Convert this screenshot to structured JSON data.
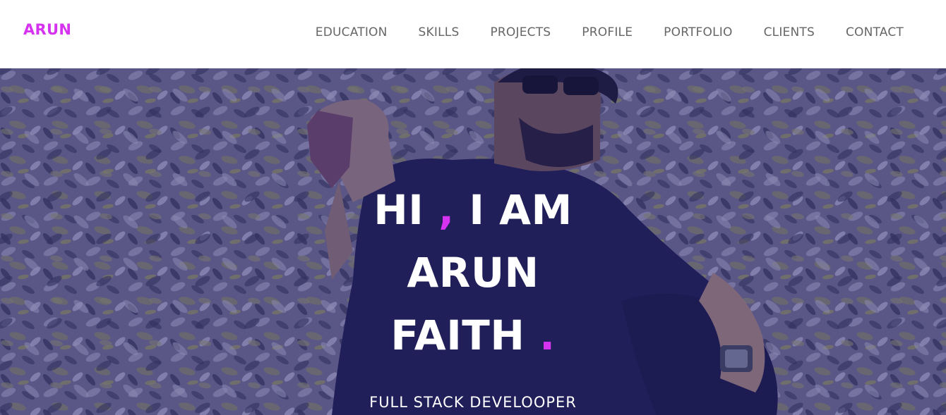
{
  "colors": {
    "accent": "#d633f0",
    "nav_text": "#666666",
    "overlay": "#2a2a6e"
  },
  "brand": {
    "name": "ARUN"
  },
  "nav": {
    "items": [
      {
        "label": "EDUCATION"
      },
      {
        "label": "SKILLS"
      },
      {
        "label": "PROJECTS"
      },
      {
        "label": "PROFILE"
      },
      {
        "label": "PORTFOLIO"
      },
      {
        "label": "CLIENTS"
      },
      {
        "label": "CONTACT"
      }
    ]
  },
  "hero": {
    "greeting": "HI",
    "comma": ",",
    "i_am": "I AM",
    "first_name": "ARUN",
    "last_name": "FAITH",
    "dot": ".",
    "subtitle": "FULL STACK DEVELOOPER"
  }
}
